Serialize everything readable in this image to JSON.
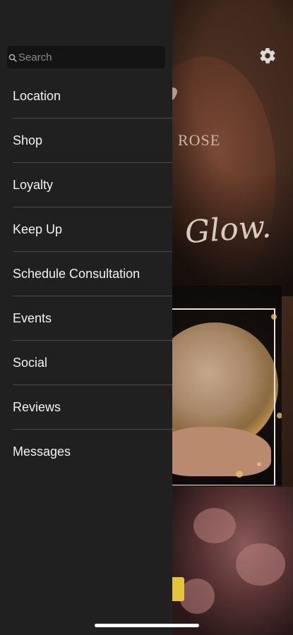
{
  "drawer": {
    "search": {
      "placeholder": "Search"
    },
    "menu_items": [
      {
        "label": "Location"
      },
      {
        "label": "Shop"
      },
      {
        "label": "Loyalty"
      },
      {
        "label": "Keep Up"
      },
      {
        "label": "Schedule Consultation"
      },
      {
        "label": "Events"
      },
      {
        "label": "Social"
      },
      {
        "label": "Reviews"
      },
      {
        "label": "Messages"
      }
    ]
  },
  "background": {
    "brand_text": "ROSE",
    "tagline": "Glow."
  },
  "icons": {
    "search": "search-icon",
    "settings": "gear-icon",
    "location": "map-pin-icon"
  },
  "colors": {
    "drawer_bg": "#202020",
    "search_bg": "#141414",
    "menu_text": "#f2f2f2",
    "accent_yellow": "#e6c43a"
  }
}
